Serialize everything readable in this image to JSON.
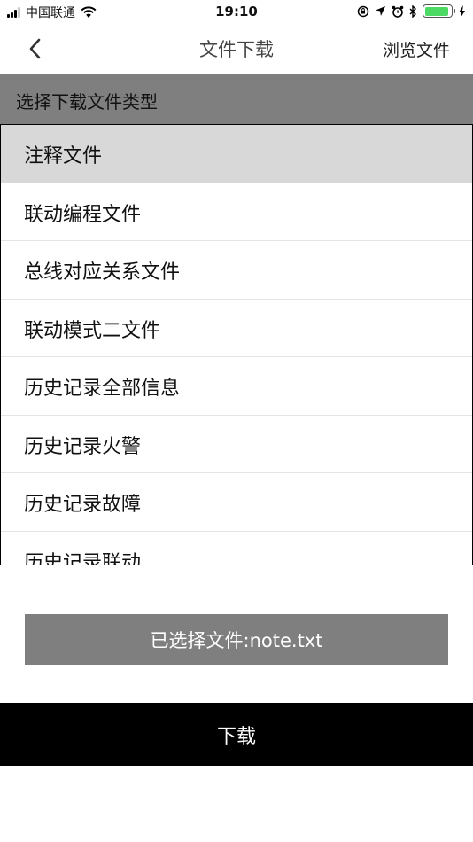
{
  "status_bar": {
    "carrier": "中国联通",
    "time": "19:10",
    "icons": [
      "signal-icon",
      "wifi-icon",
      "orientation-lock-icon",
      "location-icon",
      "alarm-icon",
      "bluetooth-icon",
      "battery-icon",
      "charging-icon"
    ],
    "battery_level": 0.9,
    "battery_color": "#4cd964"
  },
  "nav": {
    "back_icon": "chevron-left-icon",
    "title": "文件下载",
    "browse_label": "浏览文件"
  },
  "section": {
    "title": "选择下载文件类型",
    "background": "#7f7f7f"
  },
  "file_types": {
    "selected_index": 0,
    "items": [
      {
        "label": "注释文件"
      },
      {
        "label": "联动编程文件"
      },
      {
        "label": "总线对应关系文件"
      },
      {
        "label": "联动模式二文件"
      },
      {
        "label": "历史记录全部信息"
      },
      {
        "label": "历史记录火警"
      },
      {
        "label": "历史记录故障"
      },
      {
        "label": "历史记录联动"
      }
    ]
  },
  "selected_file": {
    "text": "已选择文件:note.txt"
  },
  "download": {
    "label": "下载",
    "background": "#000000"
  }
}
